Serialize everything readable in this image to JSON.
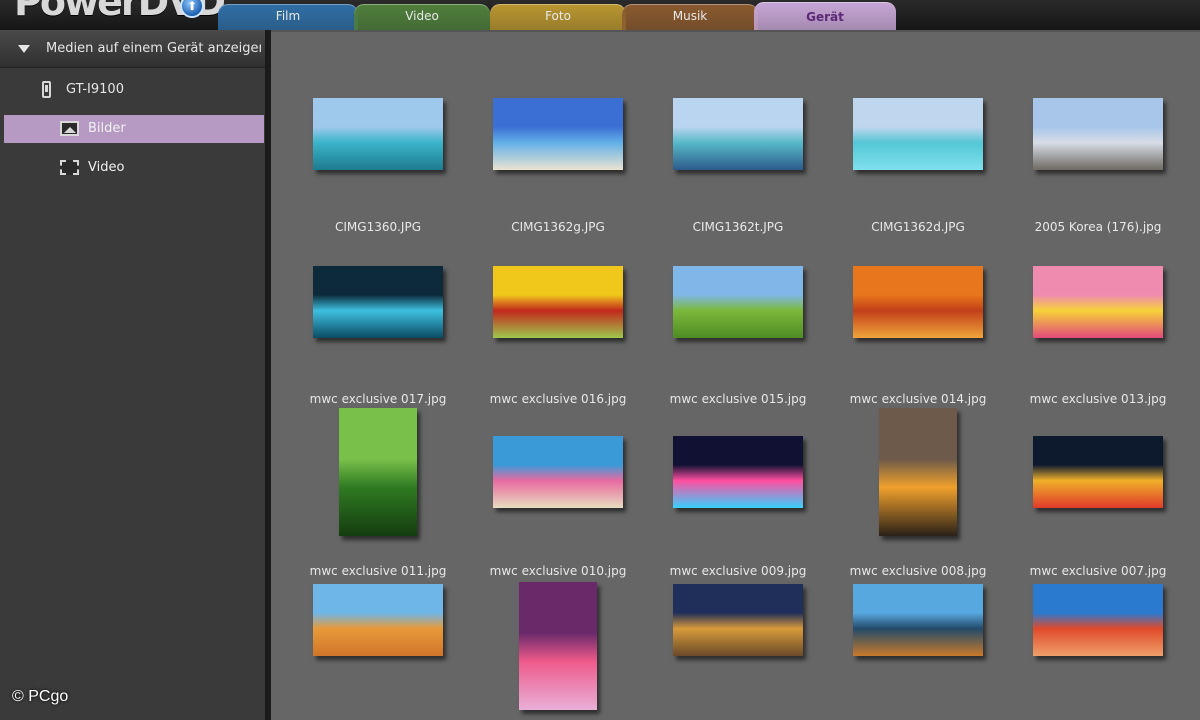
{
  "app": {
    "title": "PowerDVD"
  },
  "tabs": [
    {
      "label": "Film",
      "color": "#2f6ea6",
      "active": false
    },
    {
      "label": "Video",
      "color": "#4f7f3c",
      "active": false
    },
    {
      "label": "Foto",
      "color": "#b8962f",
      "active": false
    },
    {
      "label": "Musik",
      "color": "#8a5a2f",
      "active": false
    },
    {
      "label": "Gerät",
      "color": "#c7a6d6",
      "active": true
    }
  ],
  "sidebar": {
    "header": "Medien auf einem Gerät anzeigen",
    "device": "GT-I9100",
    "items": [
      {
        "label": "Bilder",
        "icon": "picture-icon",
        "selected": true
      },
      {
        "label": "Video",
        "icon": "film-icon",
        "selected": false
      }
    ]
  },
  "grid": {
    "items": [
      {
        "name": "CIMG1360.JPG",
        "orientation": "landscape",
        "palette": [
          "#9fc9ec",
          "#3bb4c9",
          "#1e7b8f"
        ]
      },
      {
        "name": "CIMG1362g.JPG",
        "orientation": "landscape",
        "palette": [
          "#3c6fd3",
          "#62b0e8",
          "#e9e4d0"
        ]
      },
      {
        "name": "CIMG1362t.JPG",
        "orientation": "landscape",
        "palette": [
          "#b9d5ef",
          "#57b9c8",
          "#2c5b8a"
        ]
      },
      {
        "name": "CIMG1362d.JPG",
        "orientation": "landscape",
        "palette": [
          "#bfd7ee",
          "#55c7d6",
          "#7fe0ec"
        ]
      },
      {
        "name": "2005 Korea (176).jpg",
        "orientation": "landscape",
        "palette": [
          "#a8c6ea",
          "#d8dde6",
          "#6e6a63"
        ]
      },
      {
        "name": "mwc exclusive 017.jpg",
        "orientation": "landscape",
        "palette": [
          "#0c2a3a",
          "#3ec0e0",
          "#0a4c64"
        ]
      },
      {
        "name": "mwc exclusive 016.jpg",
        "orientation": "landscape",
        "palette": [
          "#f0c81c",
          "#c2281c",
          "#9fc84c"
        ]
      },
      {
        "name": "mwc exclusive 015.jpg",
        "orientation": "landscape",
        "palette": [
          "#7fb7e8",
          "#7cb83a",
          "#4e8c24"
        ]
      },
      {
        "name": "mwc exclusive 014.jpg",
        "orientation": "landscape",
        "palette": [
          "#e8761c",
          "#c1401a",
          "#f0a43a"
        ]
      },
      {
        "name": "mwc exclusive 013.jpg",
        "orientation": "landscape",
        "palette": [
          "#f08bb0",
          "#f6d23a",
          "#e24a7c"
        ]
      },
      {
        "name": "mwc exclusive 011.jpg",
        "orientation": "portrait",
        "palette": [
          "#79c04a",
          "#2f7a22",
          "#153d10"
        ]
      },
      {
        "name": "mwc exclusive 010.jpg",
        "orientation": "landscape",
        "palette": [
          "#3a9ad8",
          "#e86aa0",
          "#e9dcc0"
        ]
      },
      {
        "name": "mwc exclusive 009.jpg",
        "orientation": "landscape",
        "palette": [
          "#111133",
          "#ff4fa0",
          "#38d0ff"
        ]
      },
      {
        "name": "mwc exclusive 008.jpg",
        "orientation": "portrait",
        "palette": [
          "#6e5a4a",
          "#f0a02c",
          "#2a2018"
        ]
      },
      {
        "name": "mwc exclusive 007.jpg",
        "orientation": "landscape",
        "palette": [
          "#0d1a2e",
          "#f0b02a",
          "#e03a2a"
        ]
      },
      {
        "name": "",
        "orientation": "landscape",
        "palette": [
          "#6fb6e8",
          "#e89a3a",
          "#d0742a"
        ]
      },
      {
        "name": "",
        "orientation": "portrait",
        "palette": [
          "#6a2a6a",
          "#ee5a8a",
          "#e8b0d8"
        ]
      },
      {
        "name": "",
        "orientation": "landscape",
        "palette": [
          "#1f2f5a",
          "#d89a3a",
          "#6a4a2a"
        ]
      },
      {
        "name": "",
        "orientation": "landscape",
        "palette": [
          "#58a8e0",
          "#244a6a",
          "#c87a2a"
        ]
      },
      {
        "name": "",
        "orientation": "landscape",
        "palette": [
          "#2a7ad0",
          "#e04a2a",
          "#f0a06a"
        ]
      }
    ]
  },
  "watermark": "© PCgo"
}
